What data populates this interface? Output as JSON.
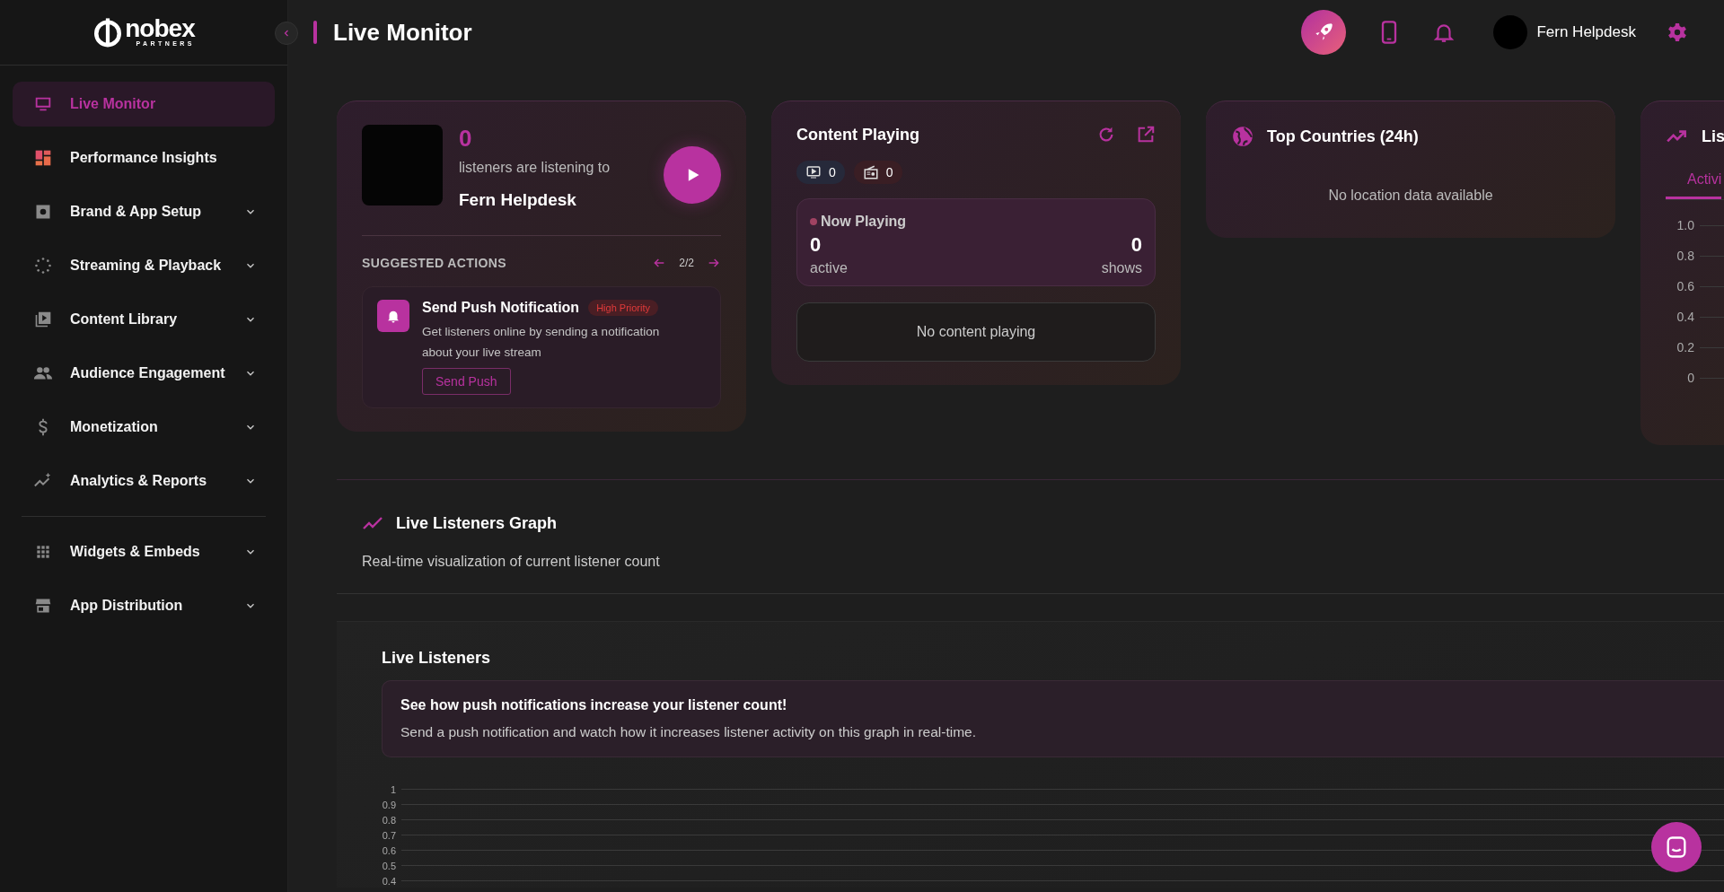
{
  "sidebar": {
    "logo": {
      "wordmark": "nobex",
      "tagline": "PARTNERS"
    },
    "groups": [
      [
        {
          "label": "Live Monitor",
          "selected": true,
          "has_submenu": false
        },
        {
          "label": "Performance Insights",
          "selected": false,
          "has_submenu": false
        },
        {
          "label": "Brand & App Setup",
          "selected": false,
          "has_submenu": true
        },
        {
          "label": "Streaming & Playback",
          "selected": false,
          "has_submenu": true
        },
        {
          "label": "Content Library",
          "selected": false,
          "has_submenu": true
        },
        {
          "label": "Audience Engagement",
          "selected": false,
          "has_submenu": true
        },
        {
          "label": "Monetization",
          "selected": false,
          "has_submenu": true
        },
        {
          "label": "Analytics & Reports",
          "selected": false,
          "has_submenu": true
        }
      ],
      [
        {
          "label": "Widgets & Embeds",
          "selected": false,
          "has_submenu": true
        },
        {
          "label": "App Distribution",
          "selected": false,
          "has_submenu": true
        }
      ]
    ]
  },
  "header": {
    "title": "Live Monitor",
    "user_name": "Fern Helpdesk"
  },
  "listeners_card": {
    "count": "0",
    "caption": "listeners are listening to",
    "station": "Fern Helpdesk",
    "suggested_actions": {
      "heading": "SUGGESTED ACTIONS",
      "pager": "2/2",
      "action": {
        "title": "Send Push Notification",
        "badge": "High Priority",
        "description": "Get listeners online by sending a notification about your live stream",
        "button": "Send Push"
      }
    }
  },
  "content_card": {
    "title": "Content Playing",
    "video_count": "0",
    "radio_count": "0",
    "now_playing": {
      "label": "Now Playing",
      "active_count": "0",
      "active_label": "active",
      "shows_count": "0",
      "shows_label": "shows"
    },
    "empty_text": "No content playing"
  },
  "countries_card": {
    "title": "Top Countries (24h)",
    "empty_text": "No location data available"
  },
  "trend_card": {
    "title": "Lis",
    "tabs": [
      {
        "label": "Activi",
        "selected": true
      }
    ],
    "y_axis_labels": [
      "1.0",
      "0.8",
      "0.6",
      "0.4",
      "0.2",
      "0"
    ]
  },
  "graph_section": {
    "title": "Live Listeners Graph",
    "subtitle": "Real-time visualization of current listener count",
    "panel": {
      "title": "Live Listeners",
      "tip_title": "See how push notifications increase your listener count!",
      "tip_text": "Send a push notification and watch how it increases listener activity on this graph in real-time.",
      "y_axis_labels": [
        "1",
        "0.9",
        "0.8",
        "0.7",
        "0.6",
        "0.5",
        "0.4"
      ]
    }
  }
}
